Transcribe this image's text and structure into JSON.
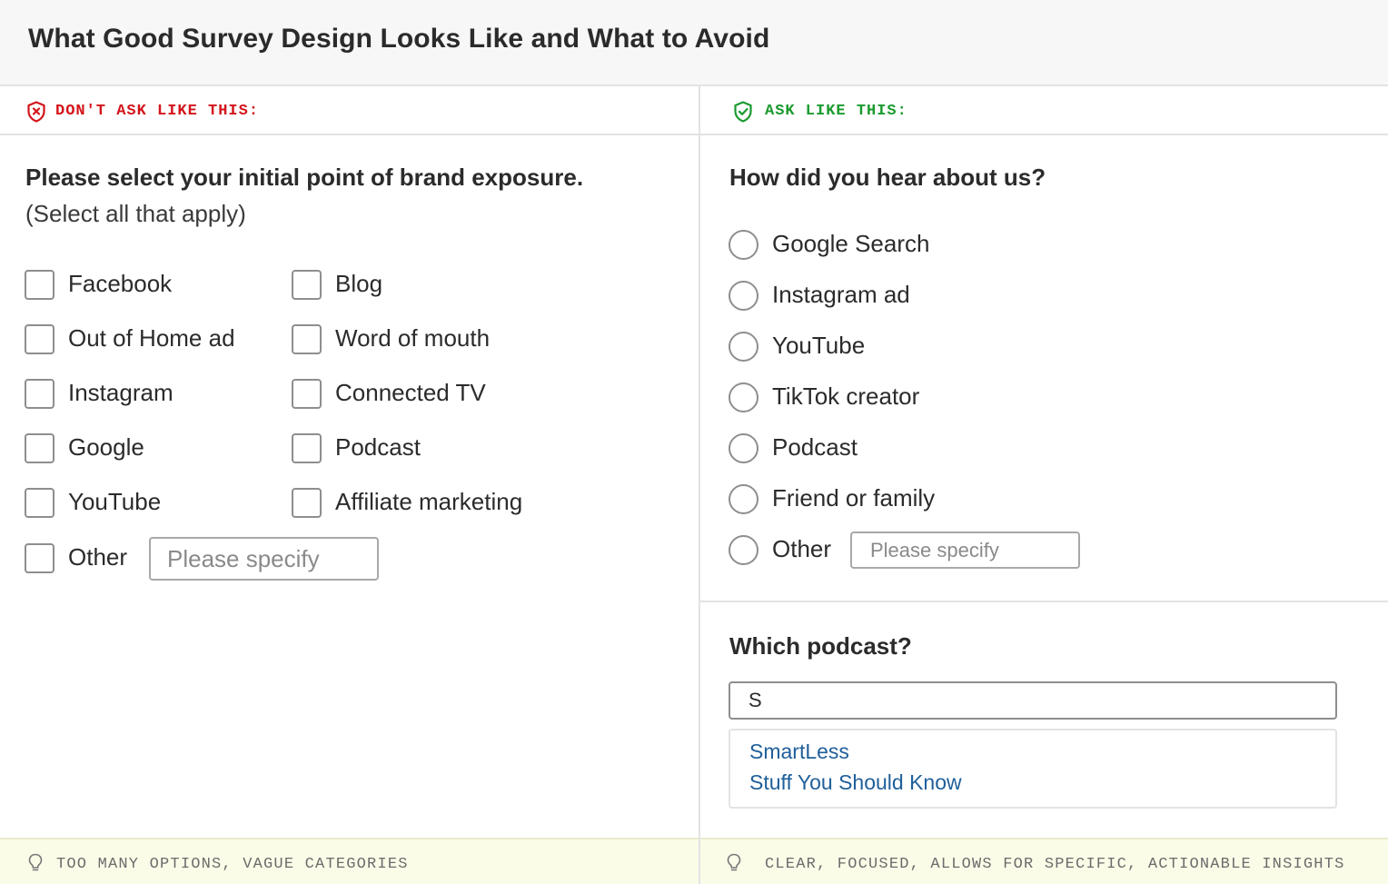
{
  "page": {
    "title": "What Good Survey Design Looks Like and What to Avoid"
  },
  "left": {
    "header_label": "DON'T ASK LIKE THIS:",
    "header_color": "#d3141a",
    "header_icon": "shield-x-icon",
    "question": "Please select your initial point of brand exposure.",
    "question_sub": "(Select all that apply)",
    "options_col1": [
      "Facebook",
      "Out of Home ad",
      "Instagram",
      "Google",
      "YouTube",
      "Other"
    ],
    "options_col2": [
      "Blog",
      "Word of mouth",
      "Connected TV",
      "Podcast",
      "Affiliate marketing"
    ],
    "other_placeholder": "Please specify",
    "footer_tip": "TOO MANY OPTIONS, VAGUE CATEGORIES",
    "footer_icon": "lightbulb-icon"
  },
  "right": {
    "header_label": "ASK LIKE THIS:",
    "header_color": "#1a9a2e",
    "header_icon": "shield-check-icon",
    "question": "How did you hear about us?",
    "options": [
      "Google Search",
      "Instagram ad",
      "YouTube",
      "TikTok creator",
      "Podcast",
      "Friend or family",
      "Other"
    ],
    "other_placeholder": "Please specify",
    "followup_question": "Which podcast?",
    "search_value": "S",
    "suggestions": [
      "SmartLess",
      "Stuff You Should Know"
    ],
    "footer_tip": "CLEAR, FOCUSED, ALLOWS FOR SPECIFIC, ACTIONABLE INSIGHTS",
    "footer_icon": "lightbulb-icon"
  }
}
